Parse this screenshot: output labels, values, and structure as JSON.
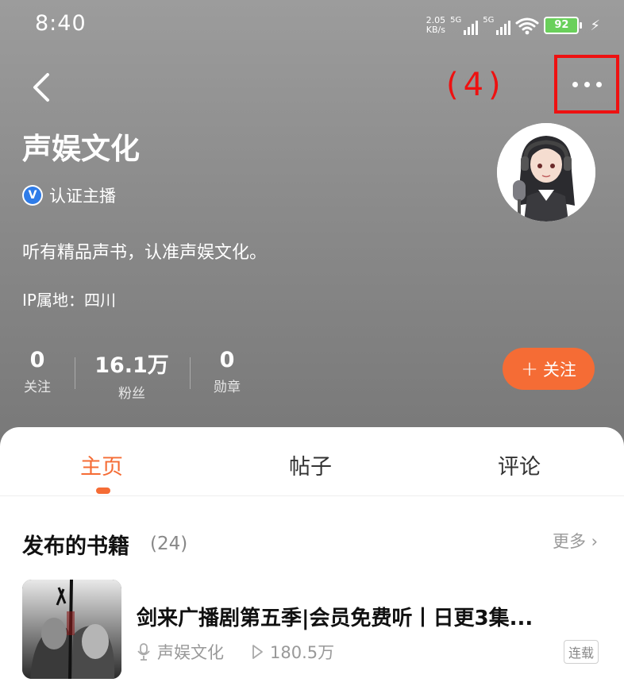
{
  "status_bar": {
    "time": "8:40",
    "net_speed_value": "2.05",
    "net_speed_unit": "KB/s",
    "signal1_label": "5G",
    "signal2_label": "5G",
    "battery_level": "92"
  },
  "header": {
    "annotation_label": "(4)",
    "back_icon": "chevron-left-icon",
    "more_icon": "ellipsis-icon"
  },
  "profile": {
    "name": "声娱文化",
    "verify_icon_text": "V",
    "verified_label": "认证主播",
    "bio": "听有精品声书，认准声娱文化。",
    "ip_location": "IP属地：四川",
    "stats": [
      {
        "value": "0",
        "label": "关注"
      },
      {
        "value": "16.1万",
        "label": "粉丝"
      },
      {
        "value": "0",
        "label": "勋章"
      }
    ],
    "follow_plus": "+",
    "follow_label": "关注"
  },
  "tabs": [
    {
      "label": "主页",
      "active": true
    },
    {
      "label": "帖子",
      "active": false
    },
    {
      "label": "评论",
      "active": false
    }
  ],
  "books_section": {
    "title": "发布的书籍",
    "count": "(24)",
    "more_label": "更多 ›",
    "books": [
      {
        "title": "剑来广播剧第五季|会员免费听丨日更3集...",
        "author": "声娱文化",
        "plays": "180.5万",
        "badge": "连载"
      }
    ]
  },
  "colors": {
    "accent": "#f56c35",
    "annotation": "#ee1111",
    "verify_blue": "#2f7ce8",
    "battery_green": "#6ad05b"
  }
}
